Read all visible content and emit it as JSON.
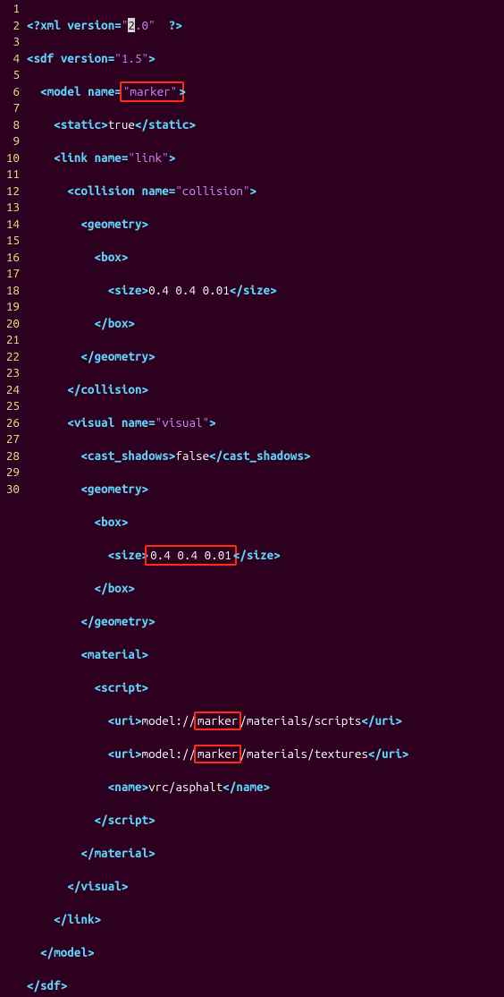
{
  "lines": {
    "gutter": [
      "1",
      "2",
      "3",
      "4",
      "5",
      "6",
      "7",
      "8",
      "9",
      "10",
      "11",
      "12",
      "13",
      "14",
      "15",
      "16",
      "17",
      "18",
      "19",
      "20",
      "21",
      "22",
      "23",
      "24",
      "25",
      "26",
      "27",
      "28",
      "29",
      "30"
    ],
    "l1": {
      "xmlDecl1": "<?",
      "xmlDecl2": "xml version",
      "eq": "=",
      "q": "\"",
      "v1": "2",
      "v2": ".0",
      "sp": "  ",
      "close": "?>"
    },
    "l2": {
      "open": "<",
      "tag": "sdf",
      "sp": " ",
      "attr": "version",
      "eq": "=",
      "val": "\"1.5\"",
      "close": ">"
    },
    "l3": {
      "ind": "  ",
      "open": "<",
      "tag": "model",
      "sp": " ",
      "attr": "name",
      "eq": "=",
      "val": "\"marker\"",
      "close": ">"
    },
    "l4": {
      "ind": "    ",
      "open": "<",
      "tag": "static",
      "close1": ">",
      "text": "true",
      "open2": "</",
      "tag2": "static",
      "close2": ">"
    },
    "l5": {
      "ind": "    ",
      "open": "<",
      "tag": "link",
      "sp": " ",
      "attr": "name",
      "eq": "=",
      "val": "\"link\"",
      "close": ">"
    },
    "l6": {
      "ind": "      ",
      "open": "<",
      "tag": "collision",
      "sp": " ",
      "attr": "name",
      "eq": "=",
      "val": "\"collision\"",
      "close": ">"
    },
    "l7": {
      "ind": "        ",
      "open": "<",
      "tag": "geometry",
      "close": ">"
    },
    "l8": {
      "ind": "          ",
      "open": "<",
      "tag": "box",
      "close": ">"
    },
    "l9": {
      "ind": "            ",
      "open": "<",
      "tag": "size",
      "close1": ">",
      "text": "0.4 0.4 0.01",
      "open2": "</",
      "tag2": "size",
      "close2": ">"
    },
    "l10": {
      "ind": "          ",
      "open": "</",
      "tag": "box",
      "close": ">"
    },
    "l11": {
      "ind": "        ",
      "open": "</",
      "tag": "geometry",
      "close": ">"
    },
    "l12": {
      "ind": "      ",
      "open": "</",
      "tag": "collision",
      "close": ">"
    },
    "l13": {
      "ind": "      ",
      "open": "<",
      "tag": "visual",
      "sp": " ",
      "attr": "name",
      "eq": "=",
      "val": "\"visual\"",
      "close": ">"
    },
    "l14": {
      "ind": "        ",
      "open": "<",
      "tag": "cast_shadows",
      "close1": ">",
      "text": "false",
      "open2": "</",
      "tag2": "cast_shadows",
      "close2": ">"
    },
    "l15": {
      "ind": "        ",
      "open": "<",
      "tag": "geometry",
      "close": ">"
    },
    "l16": {
      "ind": "          ",
      "open": "<",
      "tag": "box",
      "close": ">"
    },
    "l17": {
      "ind": "            ",
      "open": "<",
      "tag": "size",
      "close1": ">",
      "text": "0.4 0.4 0.01",
      "open2": "</",
      "tag2": "size",
      "close2": ">"
    },
    "l18": {
      "ind": "          ",
      "open": "</",
      "tag": "box",
      "close": ">"
    },
    "l19": {
      "ind": "        ",
      "open": "</",
      "tag": "geometry",
      "close": ">"
    },
    "l20": {
      "ind": "        ",
      "open": "<",
      "tag": "material",
      "close": ">"
    },
    "l21": {
      "ind": "          ",
      "open": "<",
      "tag": "script",
      "close": ">"
    },
    "l22": {
      "ind": "            ",
      "open": "<",
      "tag": "uri",
      "close1": ">",
      "pre": "model://",
      "mid": "marker",
      "post": "/materials/scripts",
      "open2": "</",
      "tag2": "uri",
      "close2": ">"
    },
    "l23": {
      "ind": "            ",
      "open": "<",
      "tag": "uri",
      "close1": ">",
      "pre": "model://",
      "mid": "marker",
      "post": "/materials/textures",
      "open2": "</",
      "tag2": "uri",
      "close2": ">"
    },
    "l24": {
      "ind": "            ",
      "open": "<",
      "tag": "name",
      "close1": ">",
      "text": "vrc/asphalt",
      "open2": "</",
      "tag2": "name",
      "close2": ">"
    },
    "l25": {
      "ind": "          ",
      "open": "</",
      "tag": "script",
      "close": ">"
    },
    "l26": {
      "ind": "        ",
      "open": "</",
      "tag": "material",
      "close": ">"
    },
    "l27": {
      "ind": "      ",
      "open": "</",
      "tag": "visual",
      "close": ">"
    },
    "l28": {
      "ind": "    ",
      "open": "</",
      "tag": "link",
      "close": ">"
    },
    "l29": {
      "ind": "  ",
      "open": "</",
      "tag": "model",
      "close": ">"
    },
    "l30": {
      "ind": "",
      "open": "</",
      "tag": "sdf",
      "close": ">"
    }
  },
  "hler": {}
}
